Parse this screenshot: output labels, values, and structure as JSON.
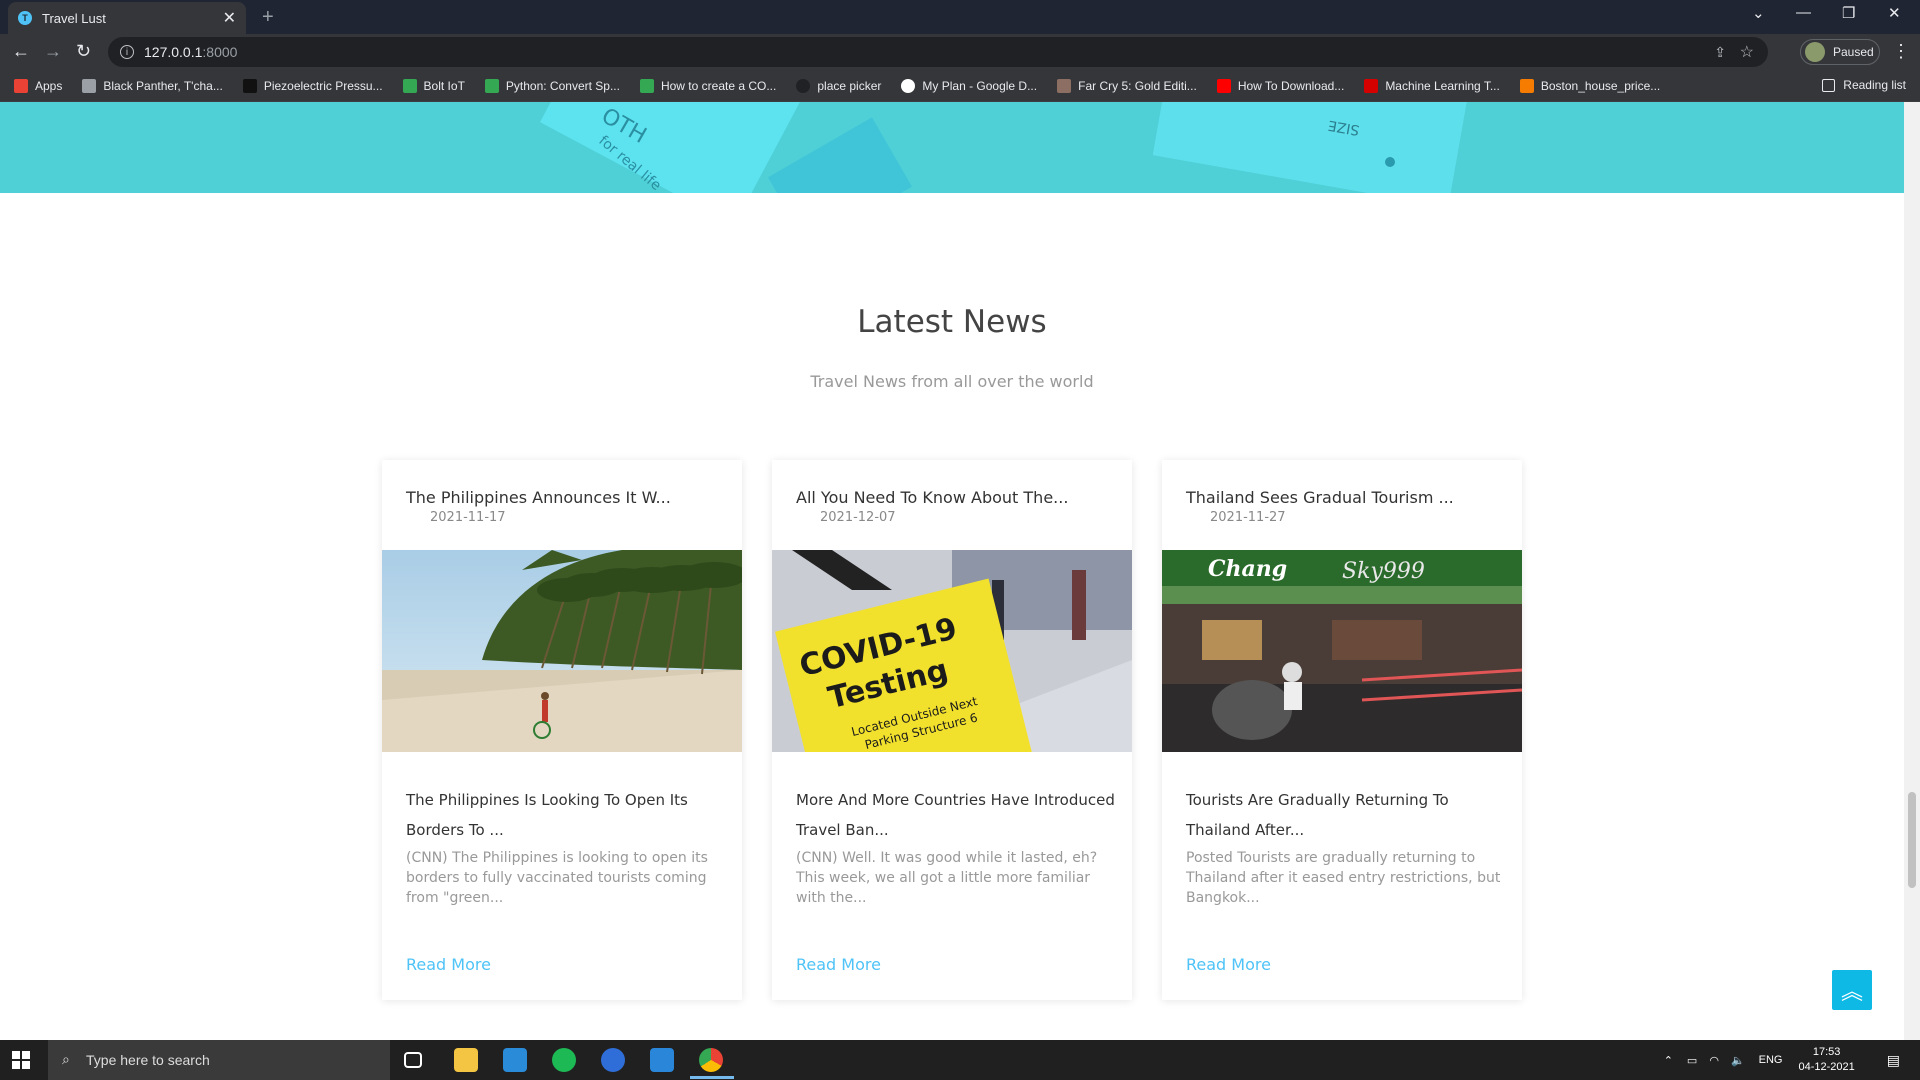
{
  "browser": {
    "tab_title": "Travel Lust",
    "tab_favicon_letter": "T",
    "url_host": "127.0.0.1",
    "url_port": ":8000",
    "profile_label": "Paused",
    "bookmarks": [
      {
        "label": "Apps",
        "color": "#ea4335"
      },
      {
        "label": "Black Panther, T'cha...",
        "color": "#9aa0a6"
      },
      {
        "label": "Piezoelectric Pressu...",
        "color": "#111111"
      },
      {
        "label": "Bolt IoT",
        "color": "#34a853"
      },
      {
        "label": "Python: Convert Sp...",
        "color": "#34a853"
      },
      {
        "label": "How to create a CO...",
        "color": "#34a853"
      },
      {
        "label": "place picker",
        "color": "#202124"
      },
      {
        "label": "My Plan - Google D...",
        "color": "#ffffff"
      },
      {
        "label": "Far Cry 5: Gold Editi...",
        "color": "#8d6e63"
      },
      {
        "label": "How To Download...",
        "color": "#ff0000"
      },
      {
        "label": "Machine Learning T...",
        "color": "#d50000"
      },
      {
        "label": "Boston_house_price...",
        "color": "#f57c00"
      }
    ],
    "reading_list": "Reading list"
  },
  "section": {
    "title": "Latest News",
    "subtitle": "Travel News from all over the world"
  },
  "news": [
    {
      "title": "The Philippines Announces It W...",
      "date": "2021-11-17",
      "headline": "The Philippines Is Looking To Open Its Borders To ...",
      "excerpt": "(CNN) The Philippines is looking to open its borders to fully vaccinated tourists coming from \"green...",
      "read_more": "Read More"
    },
    {
      "title": "All You Need To Know About The...",
      "date": "2021-12-07",
      "headline": "More And More Countries Have Introduced Travel Ban...",
      "excerpt": "(CNN) Well. It was good while it lasted, eh? This week, we all got a little more familiar with the...",
      "read_more": "Read More",
      "image_text": "COVID-19 Testing"
    },
    {
      "title": "Thailand Sees Gradual Tourism ...",
      "date": "2021-11-27",
      "headline": "Tourists Are Gradually Returning To Thailand After...",
      "excerpt": "Posted Tourists are gradually returning to Thailand after it eased entry restrictions, but Bangkok...",
      "read_more": "Read More",
      "image_sign": "Chang"
    }
  ],
  "taskbar": {
    "search_placeholder": "Type here to search",
    "lang": "ENG",
    "time": "17:53",
    "date": "04-12-2021"
  },
  "colors": {
    "accent": "#4fc3f7",
    "hero": "#4fd0d6",
    "to_top": "#0fb9e6"
  }
}
